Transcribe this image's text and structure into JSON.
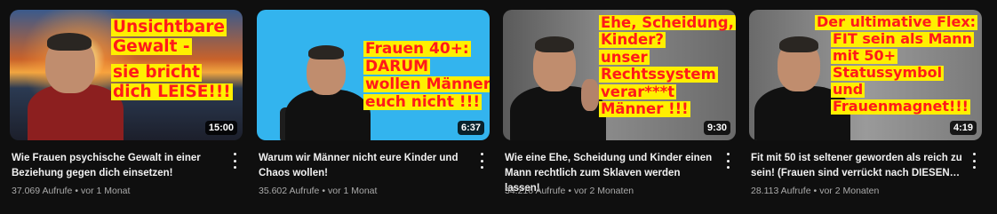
{
  "videos": [
    {
      "overlay_lines": [
        "Unsichtbare",
        "Gewalt -",
        "sie bricht",
        "dich LEISE!!!"
      ],
      "duration": "15:00",
      "title": "Wie Frauen psychische Gewalt in einer Beziehung gegen dich einsetzen!",
      "views": "37.069 Aufrufe",
      "age": "vor 1 Monat",
      "accent_bg": "#c9622a"
    },
    {
      "overlay_lines": [
        "Frauen 40+:",
        "DARUM",
        "wollen Männer",
        "euch nicht !!!"
      ],
      "duration": "6:37",
      "title": "Warum wir Männer nicht eure Kinder und Chaos wollen!",
      "views": "35.602 Aufrufe",
      "age": "vor 1 Monat",
      "accent_bg": "#33b4ee"
    },
    {
      "overlay_lines": [
        "Ehe, Scheidung,",
        "Kinder?",
        "unser",
        "Rechtssystem",
        "verar***t",
        "Männer !!!"
      ],
      "duration": "9:30",
      "title": "Wie eine Ehe, Scheidung und Kinder einen Mann rechtlich zum Sklaven werden lassen!",
      "views": "34.216 Aufrufe",
      "age": "vor 2 Monaten",
      "accent_bg": "#6e6e6e"
    },
    {
      "overlay_lines": [
        "Der ultimative Flex:",
        "FIT sein als Mann",
        "mit 50+",
        "Statussymbol",
        "und",
        "Frauenmagnet!!!"
      ],
      "duration": "4:19",
      "title": "Fit mit 50 ist seltener geworden als reich zu sein! (Frauen sind verrückt nach DIESEN…",
      "views": "28.113 Aufrufe",
      "age": "vor 2 Monaten",
      "accent_bg": "#7a7a7a"
    }
  ],
  "colors": {
    "page_bg": "#0f0f0f",
    "overlay_text": "#ff1a1a",
    "overlay_highlight": "#ffef00",
    "meta_text": "#aaaaaa"
  },
  "icons": {
    "more": "more-vert-icon"
  }
}
